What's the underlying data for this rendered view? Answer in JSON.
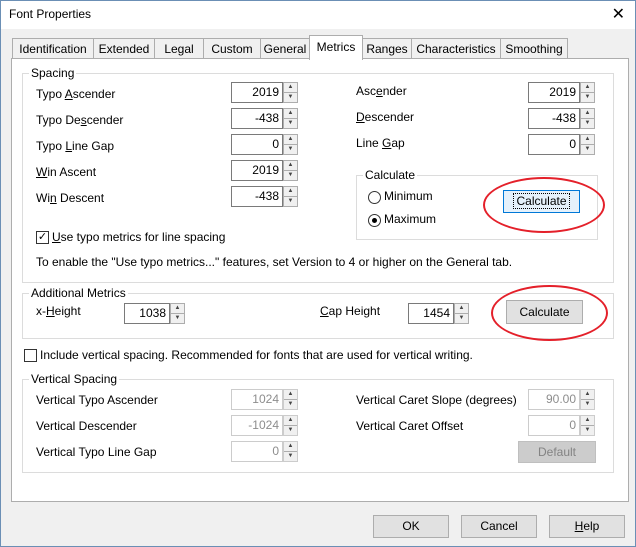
{
  "window": {
    "title": "Font Properties",
    "close_glyph": "✕"
  },
  "tabs": [
    {
      "label": "Identification"
    },
    {
      "label": "Extended"
    },
    {
      "label": "Legal"
    },
    {
      "label": "Custom"
    },
    {
      "label": "General"
    },
    {
      "label": "Metrics"
    },
    {
      "label": "Ranges"
    },
    {
      "label": "Characteristics"
    },
    {
      "label": "Smoothing"
    }
  ],
  "spacing": {
    "legend": "Spacing",
    "typo_ascender": {
      "label_a": "Typo ",
      "label_u": "A",
      "label_b": "scender",
      "value": "2019"
    },
    "typo_descender": {
      "label_a": "Typo De",
      "label_u": "s",
      "label_b": "cender",
      "value": "-438"
    },
    "typo_line_gap": {
      "label_a": "Typo ",
      "label_u": "L",
      "label_b": "ine Gap",
      "value": "0"
    },
    "win_ascent": {
      "label_a": "",
      "label_u": "W",
      "label_b": "in Ascent",
      "value": "2019"
    },
    "win_descent": {
      "label_a": "Wi",
      "label_u": "n",
      "label_b": " Descent",
      "value": "-438"
    },
    "ascender": {
      "label_a": "Asc",
      "label_u": "e",
      "label_b": "nder",
      "value": "2019"
    },
    "descender": {
      "label_a": "",
      "label_u": "D",
      "label_b": "escender",
      "value": "-438"
    },
    "line_gap": {
      "label_a": "Line ",
      "label_u": "G",
      "label_b": "ap",
      "value": "0"
    },
    "calculate": {
      "legend": "Calculate",
      "minimum_label": "Minimum",
      "maximum_label": "Maximum",
      "button_label": "Calculate"
    },
    "use_typo": {
      "label_u": "U",
      "label_b": "se typo metrics for line spacing",
      "checked": "✓"
    },
    "note": "To enable the \"Use typo metrics...\" features, set Version to 4 or higher on the General tab."
  },
  "additional": {
    "legend": "Additional Metrics",
    "x_height": {
      "label_a": "x-",
      "label_u": "H",
      "label_b": "eight",
      "value": "1038"
    },
    "cap_height": {
      "label_a": "",
      "label_u": "C",
      "label_b": "ap Height",
      "value": "1454"
    },
    "button_label": "Calculate"
  },
  "include_vertical": {
    "label": "Include vertical spacing. Recommended for fonts that are used for vertical writing."
  },
  "vertical": {
    "legend": "Vertical Spacing",
    "typo_ascender": {
      "label": "Vertical Typo Ascender",
      "value": "1024"
    },
    "descender": {
      "label": "Vertical Descender",
      "value": "-1024"
    },
    "typo_line_gap": {
      "label": "Vertical Typo Line Gap",
      "value": "0"
    },
    "caret_slope": {
      "label": "Vertical Caret Slope (degrees)",
      "value": "90.00"
    },
    "caret_offset": {
      "label": "Vertical Caret Offset",
      "value": "0"
    },
    "default_label": "Default"
  },
  "footer": {
    "ok": "OK",
    "cancel": "Cancel",
    "help_u": "H",
    "help_b": "elp"
  },
  "colors": {
    "annotation": "#e4202a",
    "focus": "#0078d7"
  }
}
